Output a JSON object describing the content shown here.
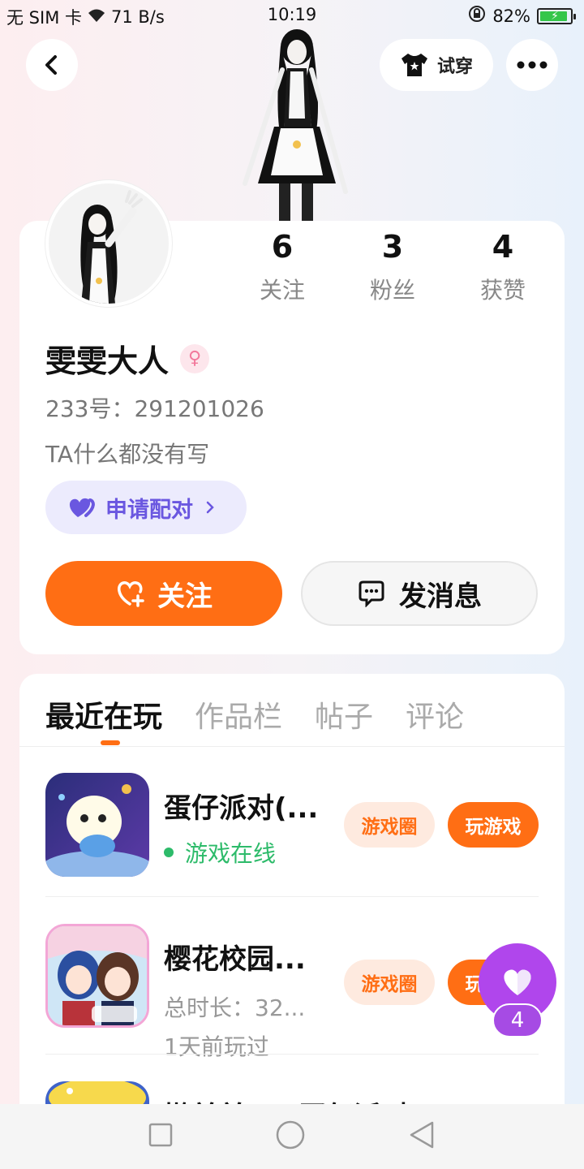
{
  "status_bar": {
    "carrier": "无 SIM 卡",
    "speed": "71 B/s",
    "time": "10:19",
    "battery": "82%",
    "battery_level": 0.82
  },
  "header": {
    "tryon_label": "试穿"
  },
  "profile": {
    "stats": [
      {
        "num": "6",
        "label": "关注"
      },
      {
        "num": "3",
        "label": "粉丝"
      },
      {
        "num": "4",
        "label": "获赞"
      }
    ],
    "nickname": "雯雯大人",
    "gender_symbol": "♀",
    "uid": "233号：291201026",
    "bio": "TA什么都没有写",
    "pair_label": "申请配对",
    "follow_label": "关注",
    "message_label": "发消息"
  },
  "tabs": [
    "最近在玩",
    "作品栏",
    "帖子",
    "评论"
  ],
  "games": [
    {
      "name": "蛋仔派对(...",
      "line1": "游戏在线",
      "circle_label": "游戏圈",
      "play_label": "玩游戏"
    },
    {
      "name": "樱花校园...",
      "line1": "总时长：32...",
      "line2": "1天前玩过",
      "circle_label": "游戏圈",
      "play_label": "玩游戏"
    },
    {
      "name": "懒羊羊up(蛋仔派对)"
    }
  ],
  "float_count": "4",
  "colors": {
    "accent": "#ff6e14",
    "online": "#2dbb6a",
    "pair": "#6a57e0",
    "float": "#b046ec"
  }
}
